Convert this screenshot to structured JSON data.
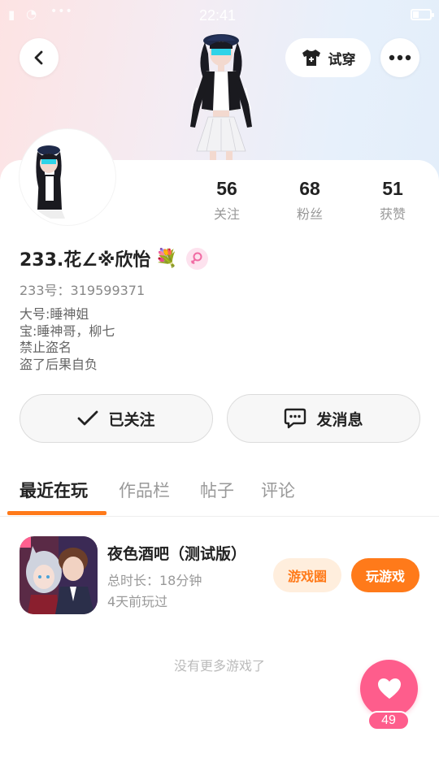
{
  "status_bar": {
    "time": "22:41"
  },
  "header": {
    "tryon_label": "试穿",
    "icons": {
      "back": "chevron-left-icon",
      "more": "ellipsis-icon",
      "tryon": "tshirt-icon"
    }
  },
  "profile": {
    "nickname": "233.花∠※欣怡",
    "id_label": "233号：319599371",
    "bio_lines": [
      "大号:睡神姐",
      "宝:睡神哥，柳七",
      "禁止盗名",
      "盗了后果自负"
    ],
    "gender": "female"
  },
  "stats": [
    {
      "value": "56",
      "label": "关注"
    },
    {
      "value": "68",
      "label": "粉丝"
    },
    {
      "value": "51",
      "label": "获赞"
    }
  ],
  "actions": {
    "follow_label": "已关注",
    "message_label": "发消息"
  },
  "tabs": [
    "最近在玩",
    "作品栏",
    "帖子",
    "评论"
  ],
  "active_tab": "最近在玩",
  "games": [
    {
      "title": "夜色酒吧（测试版）",
      "duration": "总时长：18分钟",
      "last_played": "4天前玩过",
      "circle_label": "游戏圈",
      "play_label": "玩游戏"
    }
  ],
  "empty_hint": "没有更多游戏了",
  "likes": {
    "count": "49"
  },
  "colors": {
    "accent": "#ff7a1a",
    "like": "#fe5d8c",
    "gender_badge": "#fde2ee"
  }
}
